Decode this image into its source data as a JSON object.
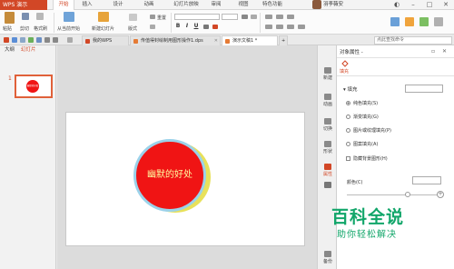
{
  "app": {
    "name": "WPS 演示",
    "menu_tabs": [
      "开始",
      "插入",
      "设计",
      "动画",
      "幻灯片放映",
      "审阅",
      "视图",
      "特色功能"
    ],
    "user_name": "羽李薇安"
  },
  "toolbar": {
    "paste": "粘贴",
    "cut": "剪切",
    "format_painter": "格式刷",
    "from_current": "从当前开始",
    "new_slide": "新建幻灯片",
    "layout": "版式",
    "reset": "重置",
    "font_value": "",
    "font_size_value": "",
    "bold": "B",
    "italic": "I",
    "underline": "U"
  },
  "doc_tabs": [
    {
      "label": "我的WPS"
    },
    {
      "label": "传值得封绘制用图形操作1.dps"
    },
    {
      "label": "演示文稿1 *"
    }
  ],
  "search_placeholder": "点此查找命令",
  "left_panel": {
    "tabs": [
      "大纲",
      "幻灯片"
    ],
    "slide_number": "1",
    "thumb_text": "幽默的好处"
  },
  "slide": {
    "shape_text": "幽默的好处"
  },
  "sidebar": [
    {
      "label": "新建"
    },
    {
      "label": "动画"
    },
    {
      "label": "切换"
    },
    {
      "label": "形状"
    },
    {
      "label": "属性"
    },
    {
      "label": ""
    },
    {
      "label": "备份"
    }
  ],
  "props": {
    "title": "对象属性 -",
    "fill_tab": "填充",
    "section": "填充",
    "options": [
      "纯色填充(S)",
      "渐变填充(G)",
      "图片或纹理填充(P)",
      "图案填充(A)"
    ],
    "selected_index": 0,
    "hide_bg": "隐藏背景图形(H)",
    "color_label": "颜色(C)"
  },
  "watermark": {
    "title": "百科全说",
    "subtitle": "助你轻松解决"
  },
  "colors": {
    "accent": "#d24726",
    "shape_fill": "#f01414",
    "shape_text": "#fffaa0",
    "watermark": "#12a66a"
  }
}
